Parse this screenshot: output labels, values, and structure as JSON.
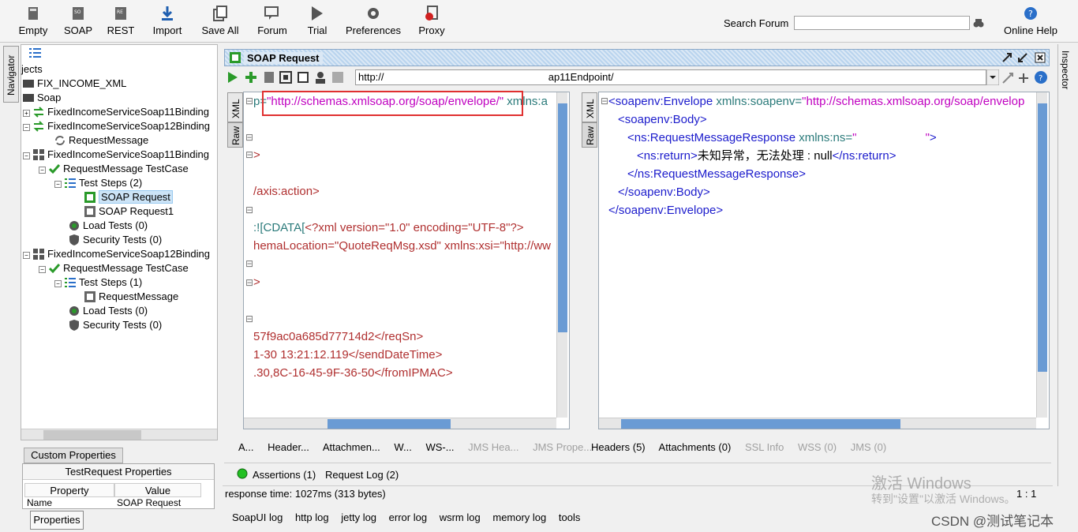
{
  "toolbar": {
    "buttons": [
      {
        "label": "Empty",
        "icon": "empty-icon"
      },
      {
        "label": "SOAP",
        "icon": "soap-icon"
      },
      {
        "label": "REST",
        "icon": "rest-icon"
      },
      {
        "label": "Import",
        "icon": "import-icon"
      },
      {
        "label": "Save All",
        "icon": "save-all-icon"
      },
      {
        "label": "Forum",
        "icon": "forum-icon"
      },
      {
        "label": "Trial",
        "icon": "trial-icon"
      },
      {
        "label": "Preferences",
        "icon": "gear-icon"
      },
      {
        "label": "Proxy",
        "icon": "proxy-icon"
      }
    ],
    "search_label": "Search Forum",
    "search_value": "",
    "help_label": "Online Help"
  },
  "navigator": {
    "tab_label": "Navigator",
    "tree": [
      {
        "label": "jects"
      },
      {
        "label": "FIX_INCOME_XML"
      },
      {
        "label": "Soap"
      },
      {
        "label": "FixedIncomeServiceSoap11Binding"
      },
      {
        "label": "FixedIncomeServiceSoap12Binding"
      },
      {
        "label": "RequestMessage"
      },
      {
        "label": "FixedIncomeServiceSoap11Binding"
      },
      {
        "label": "RequestMessage TestCase"
      },
      {
        "label": "Test Steps (2)"
      },
      {
        "label": "SOAP Request"
      },
      {
        "label": "SOAP Request1"
      },
      {
        "label": "Load Tests (0)"
      },
      {
        "label": "Security Tests (0)"
      },
      {
        "label": "FixedIncomeServiceSoap12Binding"
      },
      {
        "label": "RequestMessage TestCase"
      },
      {
        "label": "Test Steps (1)"
      },
      {
        "label": "RequestMessage"
      },
      {
        "label": "Load Tests (0)"
      },
      {
        "label": "Security Tests (0)"
      }
    ]
  },
  "custom_properties": {
    "tab": "Custom Properties",
    "header": "TestRequest Properties",
    "col_property": "Property",
    "col_value": "Value",
    "row_name": "Name",
    "row_value": "SOAP Request",
    "properties_button": "Properties"
  },
  "request": {
    "title": "SOAP Request",
    "url": "http://                                                                                ap11Endpoint/",
    "left_tabs": {
      "xml": "XML",
      "raw": "Raw"
    },
    "left_lines": [
      {
        "a": "p=",
        "b": "\"http://schemas.xmlsoap.org/soap/envelope/\"",
        "c": " xmlns:a"
      },
      {
        "a": ">"
      },
      {
        "a": "/axis:action>"
      },
      {
        "a": ":![CDATA[",
        "b": "<?xml version=\"1.0\" encoding=\"UTF-8\"?>"
      },
      {
        "a": "hemaLocation=\"QuoteReqMsg.xsd\" xmlns:xsi=\"http://ww"
      },
      {
        "a": ">"
      },
      {
        "a": "57f9ac0a685d77714d2</reqSn>"
      },
      {
        "a": "1-30 13:21:12.119</sendDateTime>"
      },
      {
        "a": ".30,8C-16-45-9F-36-50</fromIPMAC>"
      }
    ],
    "left_bottom_tabs": [
      "A...",
      "Header...",
      "Attachmen...",
      "W...",
      "WS-...",
      "JMS Hea...",
      "JMS Prope..."
    ],
    "assertions": "Assertions (1)",
    "request_log": "Request Log (2)"
  },
  "response": {
    "tabs": {
      "xml": "XML",
      "raw": "Raw"
    },
    "lines": [
      {
        "open": "<soapenv:Envelope",
        "attr": " xmlns:soapenv=",
        "val": "\"http://schemas.xmlsoap.org/soap/envelop"
      },
      {
        "open": "<soapenv:Body>"
      },
      {
        "open": "<ns:RequestMessageResponse",
        "attr": " xmlns:ns=",
        "val": "\"                             \"",
        "end": ">"
      },
      {
        "open": "<ns:return>",
        "text": "未知异常，无法处理 : null",
        "close": "</ns:return>"
      },
      {
        "open": "</ns:RequestMessageResponse>"
      },
      {
        "open": "</soapenv:Body>"
      },
      {
        "open": "</soapenv:Envelope>"
      }
    ],
    "bottom_tabs": [
      {
        "label": "Headers (5)",
        "disabled": false
      },
      {
        "label": "Attachments (0)",
        "disabled": false
      },
      {
        "label": "SSL Info",
        "disabled": true
      },
      {
        "label": "WSS (0)",
        "disabled": true
      },
      {
        "label": "JMS (0)",
        "disabled": true
      }
    ],
    "zoom": "1 : 1"
  },
  "status": {
    "response_time": "response time: 1027ms (313 bytes)"
  },
  "bottom_tabs": [
    "SoapUI log",
    "http log",
    "jetty log",
    "error log",
    "wsrm log",
    "memory log",
    "tools"
  ],
  "inspector_label": "Inspector",
  "watermark": {
    "line1": "激活 Windows",
    "line2": "转到\"设置\"以激活 Windows。",
    "credit": "CSDN @测试笔记本"
  },
  "colors": {
    "accent": "#6a9bd4",
    "highlight": "#e03030",
    "tag": "#1c1ccc",
    "string": "#c000c0"
  }
}
